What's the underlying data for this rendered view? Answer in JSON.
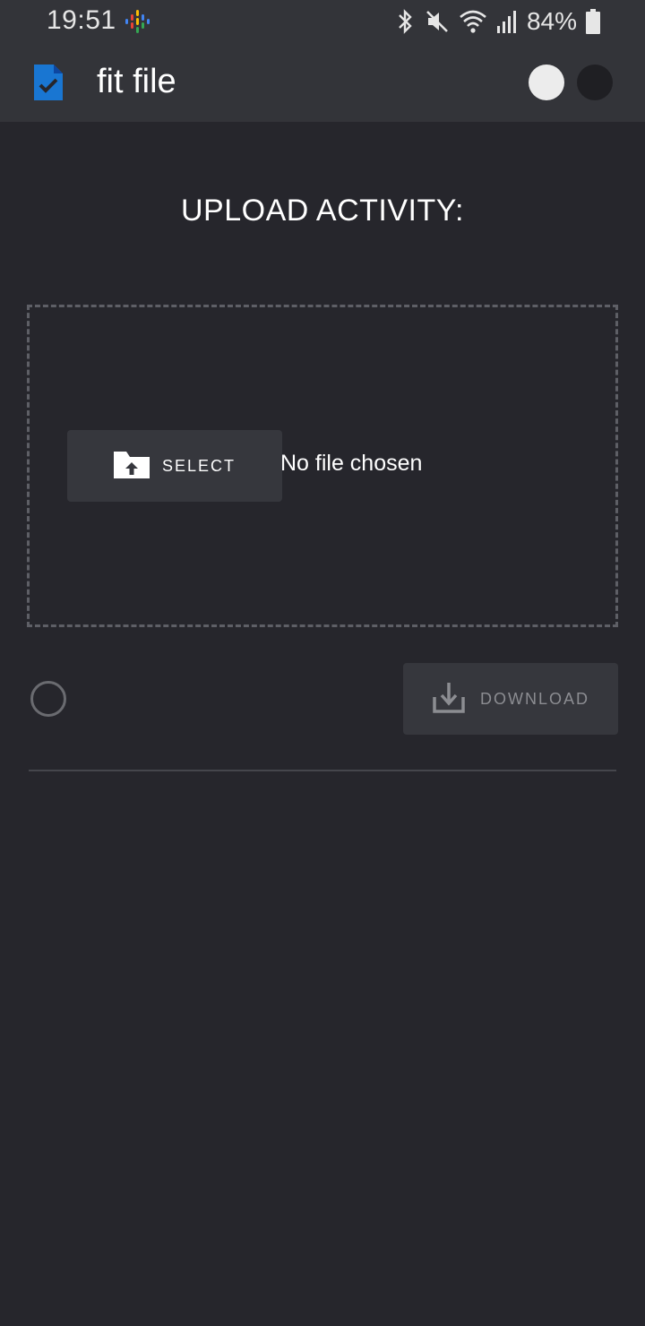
{
  "status_bar": {
    "time": "19:51",
    "battery": "84%",
    "icons": [
      "podcast-icon",
      "bluetooth-icon",
      "mute-icon",
      "wifi-icon",
      "signal-icon",
      "battery-icon"
    ]
  },
  "app_bar": {
    "title": "fit file",
    "logo_icon": "file-check-icon",
    "logo_color": "#1976d2",
    "theme_toggle": {
      "options": [
        "light",
        "dark"
      ],
      "selected": "light"
    }
  },
  "main": {
    "heading": "UPLOAD ACTIVITY:",
    "select_button": {
      "label": "SELECT",
      "icon": "folder-upload-icon"
    },
    "file_status": "No file chosen",
    "download_button": {
      "label": "DOWNLOAD",
      "icon": "download-icon",
      "disabled": true
    }
  },
  "colors": {
    "background": "#26262c",
    "bar": "#333439",
    "button": "#36373d",
    "disabled_text": "#8c8d92"
  }
}
